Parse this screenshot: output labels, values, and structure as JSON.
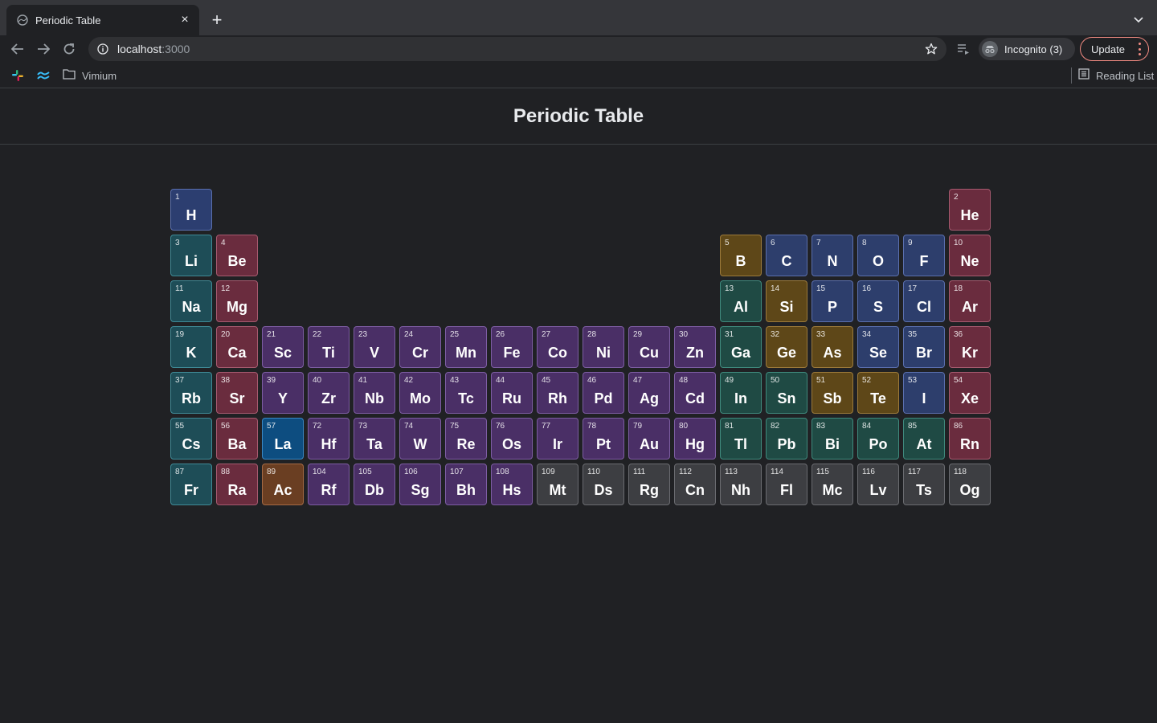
{
  "browser": {
    "tab_title": "Periodic Table",
    "url_host": "localhost",
    "url_port": ":3000",
    "profile_label": "Incognito (3)",
    "update_label": "Update",
    "bookmarks": [
      {
        "name": "slack-icon"
      },
      {
        "name": "tailwind-icon"
      },
      {
        "name": "Vimium",
        "icon": "folder-icon"
      }
    ],
    "reading_list_label": "Reading List"
  },
  "page": {
    "title": "Periodic Table"
  },
  "colors": {
    "hydrogen": "#2c3e70",
    "alkali_metal": "#1e4d57",
    "alkaline_earth_metal": "#6a2c3e",
    "transition_metal": "#4a2f66",
    "post_transition_metal": "#1f4a44",
    "metalloid": "#5e4718",
    "nonmetal": "#2d3e6c",
    "noble_gas": "#6a2c3e",
    "lanthanide": "#0d4d80",
    "actinide": "#6a3e22",
    "unknown": "#3d3e42"
  },
  "elements": [
    {
      "n": "1",
      "s": "H",
      "row": 1,
      "col": 1,
      "cat": "h"
    },
    {
      "n": "2",
      "s": "He",
      "row": 1,
      "col": 18,
      "cat": "ng"
    },
    {
      "n": "3",
      "s": "Li",
      "row": 2,
      "col": 1,
      "cat": "alk"
    },
    {
      "n": "4",
      "s": "Be",
      "row": 2,
      "col": 2,
      "cat": "ae"
    },
    {
      "n": "5",
      "s": "B",
      "row": 2,
      "col": 13,
      "cat": "met"
    },
    {
      "n": "6",
      "s": "C",
      "row": 2,
      "col": 14,
      "cat": "nm"
    },
    {
      "n": "7",
      "s": "N",
      "row": 2,
      "col": 15,
      "cat": "nm"
    },
    {
      "n": "8",
      "s": "O",
      "row": 2,
      "col": 16,
      "cat": "nm"
    },
    {
      "n": "9",
      "s": "F",
      "row": 2,
      "col": 17,
      "cat": "nm"
    },
    {
      "n": "10",
      "s": "Ne",
      "row": 2,
      "col": 18,
      "cat": "ng"
    },
    {
      "n": "11",
      "s": "Na",
      "row": 3,
      "col": 1,
      "cat": "alk"
    },
    {
      "n": "12",
      "s": "Mg",
      "row": 3,
      "col": 2,
      "cat": "ae"
    },
    {
      "n": "13",
      "s": "Al",
      "row": 3,
      "col": 13,
      "cat": "pt"
    },
    {
      "n": "14",
      "s": "Si",
      "row": 3,
      "col": 14,
      "cat": "met"
    },
    {
      "n": "15",
      "s": "P",
      "row": 3,
      "col": 15,
      "cat": "nm"
    },
    {
      "n": "16",
      "s": "S",
      "row": 3,
      "col": 16,
      "cat": "nm"
    },
    {
      "n": "17",
      "s": "Cl",
      "row": 3,
      "col": 17,
      "cat": "nm"
    },
    {
      "n": "18",
      "s": "Ar",
      "row": 3,
      "col": 18,
      "cat": "ng"
    },
    {
      "n": "19",
      "s": "K",
      "row": 4,
      "col": 1,
      "cat": "alk"
    },
    {
      "n": "20",
      "s": "Ca",
      "row": 4,
      "col": 2,
      "cat": "ae"
    },
    {
      "n": "21",
      "s": "Sc",
      "row": 4,
      "col": 3,
      "cat": "tm"
    },
    {
      "n": "22",
      "s": "Ti",
      "row": 4,
      "col": 4,
      "cat": "tm"
    },
    {
      "n": "23",
      "s": "V",
      "row": 4,
      "col": 5,
      "cat": "tm"
    },
    {
      "n": "24",
      "s": "Cr",
      "row": 4,
      "col": 6,
      "cat": "tm"
    },
    {
      "n": "25",
      "s": "Mn",
      "row": 4,
      "col": 7,
      "cat": "tm"
    },
    {
      "n": "26",
      "s": "Fe",
      "row": 4,
      "col": 8,
      "cat": "tm"
    },
    {
      "n": "27",
      "s": "Co",
      "row": 4,
      "col": 9,
      "cat": "tm"
    },
    {
      "n": "28",
      "s": "Ni",
      "row": 4,
      "col": 10,
      "cat": "tm"
    },
    {
      "n": "29",
      "s": "Cu",
      "row": 4,
      "col": 11,
      "cat": "tm"
    },
    {
      "n": "30",
      "s": "Zn",
      "row": 4,
      "col": 12,
      "cat": "tm"
    },
    {
      "n": "31",
      "s": "Ga",
      "row": 4,
      "col": 13,
      "cat": "pt"
    },
    {
      "n": "32",
      "s": "Ge",
      "row": 4,
      "col": 14,
      "cat": "met"
    },
    {
      "n": "33",
      "s": "As",
      "row": 4,
      "col": 15,
      "cat": "met"
    },
    {
      "n": "34",
      "s": "Se",
      "row": 4,
      "col": 16,
      "cat": "nm"
    },
    {
      "n": "35",
      "s": "Br",
      "row": 4,
      "col": 17,
      "cat": "nm"
    },
    {
      "n": "36",
      "s": "Kr",
      "row": 4,
      "col": 18,
      "cat": "ng"
    },
    {
      "n": "37",
      "s": "Rb",
      "row": 5,
      "col": 1,
      "cat": "alk"
    },
    {
      "n": "38",
      "s": "Sr",
      "row": 5,
      "col": 2,
      "cat": "ae"
    },
    {
      "n": "39",
      "s": "Y",
      "row": 5,
      "col": 3,
      "cat": "tm"
    },
    {
      "n": "40",
      "s": "Zr",
      "row": 5,
      "col": 4,
      "cat": "tm"
    },
    {
      "n": "41",
      "s": "Nb",
      "row": 5,
      "col": 5,
      "cat": "tm"
    },
    {
      "n": "42",
      "s": "Mo",
      "row": 5,
      "col": 6,
      "cat": "tm"
    },
    {
      "n": "43",
      "s": "Tc",
      "row": 5,
      "col": 7,
      "cat": "tm"
    },
    {
      "n": "44",
      "s": "Ru",
      "row": 5,
      "col": 8,
      "cat": "tm"
    },
    {
      "n": "45",
      "s": "Rh",
      "row": 5,
      "col": 9,
      "cat": "tm"
    },
    {
      "n": "46",
      "s": "Pd",
      "row": 5,
      "col": 10,
      "cat": "tm"
    },
    {
      "n": "47",
      "s": "Ag",
      "row": 5,
      "col": 11,
      "cat": "tm"
    },
    {
      "n": "48",
      "s": "Cd",
      "row": 5,
      "col": 12,
      "cat": "tm"
    },
    {
      "n": "49",
      "s": "In",
      "row": 5,
      "col": 13,
      "cat": "pt"
    },
    {
      "n": "50",
      "s": "Sn",
      "row": 5,
      "col": 14,
      "cat": "pt"
    },
    {
      "n": "51",
      "s": "Sb",
      "row": 5,
      "col": 15,
      "cat": "met"
    },
    {
      "n": "52",
      "s": "Te",
      "row": 5,
      "col": 16,
      "cat": "met"
    },
    {
      "n": "53",
      "s": "I",
      "row": 5,
      "col": 17,
      "cat": "nm"
    },
    {
      "n": "54",
      "s": "Xe",
      "row": 5,
      "col": 18,
      "cat": "ng"
    },
    {
      "n": "55",
      "s": "Cs",
      "row": 6,
      "col": 1,
      "cat": "alk"
    },
    {
      "n": "56",
      "s": "Ba",
      "row": 6,
      "col": 2,
      "cat": "ae"
    },
    {
      "n": "57",
      "s": "La",
      "row": 6,
      "col": 3,
      "cat": "la"
    },
    {
      "n": "72",
      "s": "Hf",
      "row": 6,
      "col": 4,
      "cat": "tm"
    },
    {
      "n": "73",
      "s": "Ta",
      "row": 6,
      "col": 5,
      "cat": "tm"
    },
    {
      "n": "74",
      "s": "W",
      "row": 6,
      "col": 6,
      "cat": "tm"
    },
    {
      "n": "75",
      "s": "Re",
      "row": 6,
      "col": 7,
      "cat": "tm"
    },
    {
      "n": "76",
      "s": "Os",
      "row": 6,
      "col": 8,
      "cat": "tm"
    },
    {
      "n": "77",
      "s": "Ir",
      "row": 6,
      "col": 9,
      "cat": "tm"
    },
    {
      "n": "78",
      "s": "Pt",
      "row": 6,
      "col": 10,
      "cat": "tm"
    },
    {
      "n": "79",
      "s": "Au",
      "row": 6,
      "col": 11,
      "cat": "tm"
    },
    {
      "n": "80",
      "s": "Hg",
      "row": 6,
      "col": 12,
      "cat": "tm"
    },
    {
      "n": "81",
      "s": "Tl",
      "row": 6,
      "col": 13,
      "cat": "pt"
    },
    {
      "n": "82",
      "s": "Pb",
      "row": 6,
      "col": 14,
      "cat": "pt"
    },
    {
      "n": "83",
      "s": "Bi",
      "row": 6,
      "col": 15,
      "cat": "pt"
    },
    {
      "n": "84",
      "s": "Po",
      "row": 6,
      "col": 16,
      "cat": "pt"
    },
    {
      "n": "85",
      "s": "At",
      "row": 6,
      "col": 17,
      "cat": "pt"
    },
    {
      "n": "86",
      "s": "Rn",
      "row": 6,
      "col": 18,
      "cat": "ng"
    },
    {
      "n": "87",
      "s": "Fr",
      "row": 7,
      "col": 1,
      "cat": "alk"
    },
    {
      "n": "88",
      "s": "Ra",
      "row": 7,
      "col": 2,
      "cat": "ae"
    },
    {
      "n": "89",
      "s": "Ac",
      "row": 7,
      "col": 3,
      "cat": "ac"
    },
    {
      "n": "104",
      "s": "Rf",
      "row": 7,
      "col": 4,
      "cat": "tm"
    },
    {
      "n": "105",
      "s": "Db",
      "row": 7,
      "col": 5,
      "cat": "tm"
    },
    {
      "n": "106",
      "s": "Sg",
      "row": 7,
      "col": 6,
      "cat": "tm"
    },
    {
      "n": "107",
      "s": "Bh",
      "row": 7,
      "col": 7,
      "cat": "tm"
    },
    {
      "n": "108",
      "s": "Hs",
      "row": 7,
      "col": 8,
      "cat": "tm"
    },
    {
      "n": "109",
      "s": "Mt",
      "row": 7,
      "col": 9,
      "cat": "unk"
    },
    {
      "n": "110",
      "s": "Ds",
      "row": 7,
      "col": 10,
      "cat": "unk"
    },
    {
      "n": "111",
      "s": "Rg",
      "row": 7,
      "col": 11,
      "cat": "unk"
    },
    {
      "n": "112",
      "s": "Cn",
      "row": 7,
      "col": 12,
      "cat": "unk"
    },
    {
      "n": "113",
      "s": "Nh",
      "row": 7,
      "col": 13,
      "cat": "unk"
    },
    {
      "n": "114",
      "s": "Fl",
      "row": 7,
      "col": 14,
      "cat": "unk"
    },
    {
      "n": "115",
      "s": "Mc",
      "row": 7,
      "col": 15,
      "cat": "unk"
    },
    {
      "n": "116",
      "s": "Lv",
      "row": 7,
      "col": 16,
      "cat": "unk"
    },
    {
      "n": "117",
      "s": "Ts",
      "row": 7,
      "col": 17,
      "cat": "unk"
    },
    {
      "n": "118",
      "s": "Og",
      "row": 7,
      "col": 18,
      "cat": "unk"
    }
  ]
}
